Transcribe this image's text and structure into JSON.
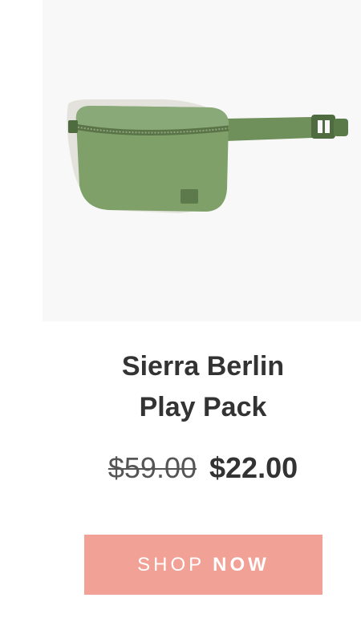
{
  "product": {
    "image_alt": "green belt bag",
    "title_line1": "Sierra Berlin",
    "title_line2": "Play Pack",
    "original_price": "$59.00",
    "sale_price": "$22.00"
  },
  "cta": {
    "label_light": "SHOP",
    "label_bold": "NOW"
  },
  "colors": {
    "bag_green": "#7fa068",
    "button": "#f2a196",
    "text": "#333333"
  }
}
